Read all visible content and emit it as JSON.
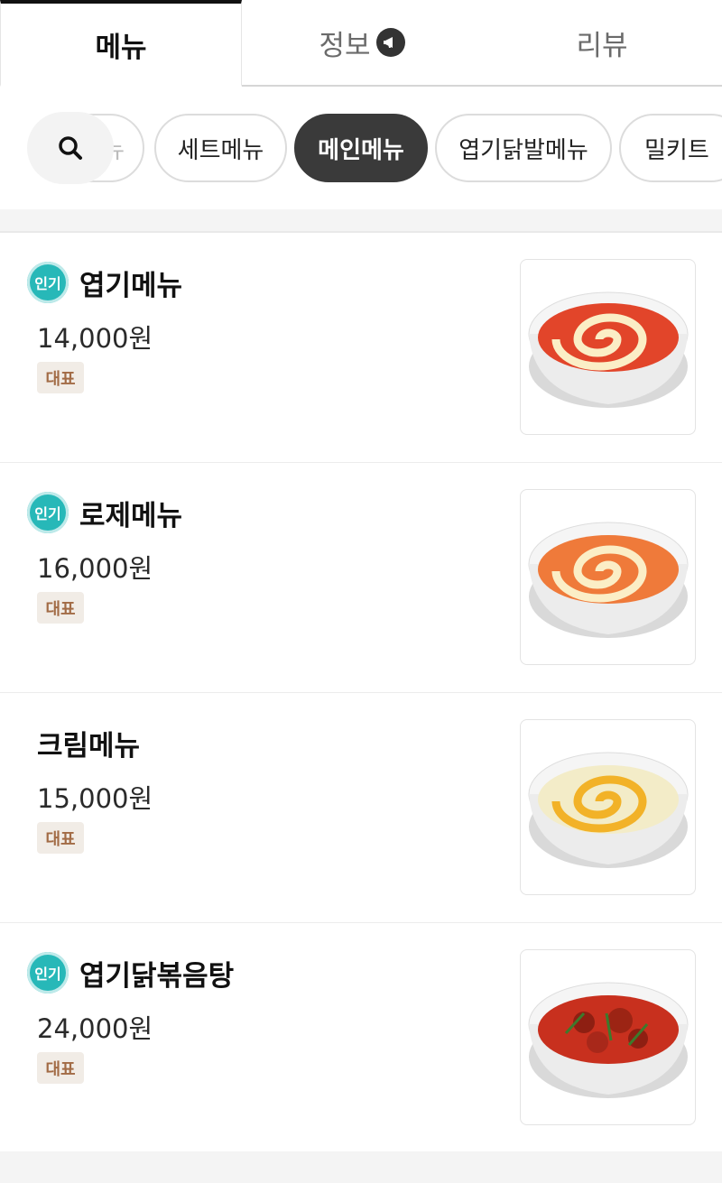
{
  "tabs": [
    {
      "label": "메뉴",
      "active": true
    },
    {
      "label": "정보",
      "active": false,
      "icon": "megaphone-icon"
    },
    {
      "label": "리뷰",
      "active": false
    }
  ],
  "search": {
    "icon": "search-icon"
  },
  "categories": {
    "partial_label": "뉴",
    "items": [
      {
        "label": "세트메뉴",
        "active": false
      },
      {
        "label": "메인메뉴",
        "active": true
      },
      {
        "label": "엽기닭발메뉴",
        "active": false
      },
      {
        "label": "밀키트",
        "active": false
      }
    ]
  },
  "menu_items": [
    {
      "name": "엽기메뉴",
      "price": "14,000원",
      "popular": true,
      "popular_label": "인기",
      "tag": "대표",
      "image": "tteokbokki-spicy-cheese-swirl",
      "sauce_color": "#e2452a"
    },
    {
      "name": "로제메뉴",
      "price": "16,000원",
      "popular": true,
      "popular_label": "인기",
      "tag": "대표",
      "image": "tteokbokki-rose-cheese-swirl",
      "sauce_color": "#ef7a3a"
    },
    {
      "name": "크림메뉴",
      "price": "15,000원",
      "popular": false,
      "popular_label": "",
      "tag": "대표",
      "image": "tteokbokki-cream-cheese-swirl",
      "sauce_color": "#f3ecc8"
    },
    {
      "name": "엽기닭볶음탕",
      "price": "24,000원",
      "popular": true,
      "popular_label": "인기",
      "tag": "대표",
      "image": "spicy-braised-chicken",
      "sauce_color": "#c8301e"
    }
  ],
  "colors": {
    "accent_teal": "#27b8b8",
    "chip_active": "#3a3a3a",
    "tag_bg": "#f1ece6",
    "tag_text": "#a26b45"
  }
}
